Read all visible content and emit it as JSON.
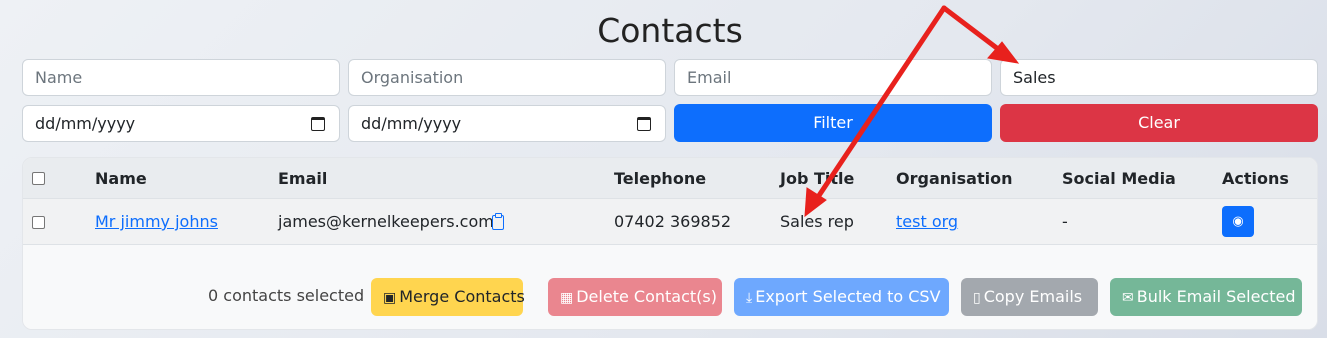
{
  "page": {
    "title": "Contacts"
  },
  "filters": {
    "name_placeholder": "Name",
    "organisation_placeholder": "Organisation",
    "email_placeholder": "Email",
    "job_title_value": "Sales",
    "date_from": "dd/mm/yyyy",
    "date_to": "dd/mm/yyyy",
    "filter_label": "Filter",
    "clear_label": "Clear"
  },
  "table": {
    "headers": [
      "Name",
      "Email",
      "Telephone",
      "Job Title",
      "Organisation",
      "Social Media",
      "Actions"
    ],
    "rows": [
      {
        "name": "Mr jimmy johns",
        "email": "james@kernelkeepers.com",
        "telephone": "07402 369852",
        "job_title": "Sales rep",
        "organisation": "test org",
        "social_media": "-"
      }
    ]
  },
  "footer": {
    "selected_count": "0 contacts selected",
    "merge_label": "Merge Contacts",
    "delete_label": "Delete Contact(s)",
    "export_label": "Export Selected to CSV",
    "copy_label": "Copy Emails",
    "bulk_label": "Bulk Email Selected"
  },
  "colors": {
    "primary": "#0d6efd",
    "danger": "#dc3545",
    "warning": "#ffd54f",
    "annotation_arrow": "#e8211d"
  },
  "icons": {
    "date": "calendar-icon",
    "email_copy": "clipboard-icon",
    "action": "view-icon",
    "merge": "merge-icon",
    "delete": "trash-icon",
    "export": "download-icon",
    "copy": "clipboard-icon",
    "bulk": "envelope-icon"
  }
}
